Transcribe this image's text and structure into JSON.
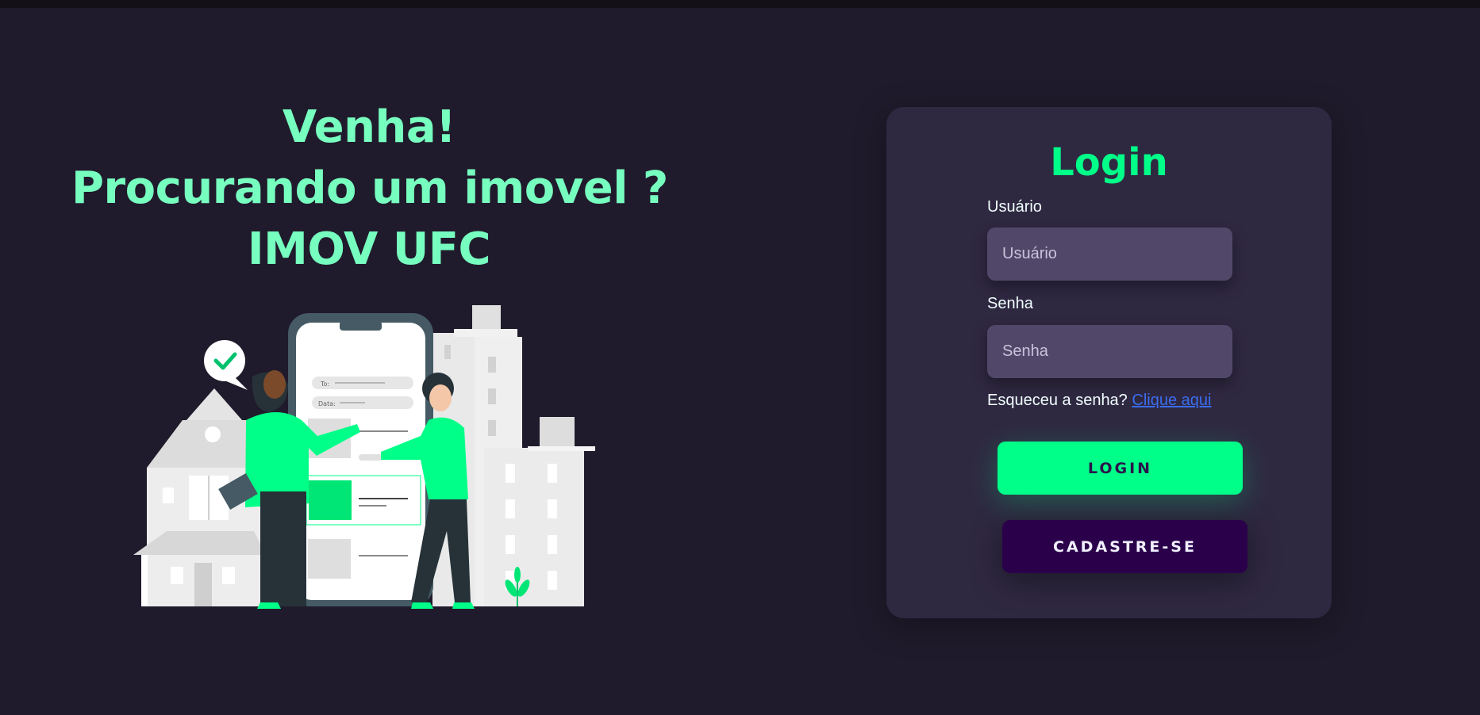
{
  "hero": {
    "line1": "Venha!",
    "line2": "Procurando um imovel ?",
    "line3": "IMOV UFC"
  },
  "illustration": {
    "search_to_label": "To:",
    "search_date_label": "Data:"
  },
  "login": {
    "title": "Login",
    "username_label": "Usuário",
    "username_placeholder": "Usuário",
    "username_value": "",
    "password_label": "Senha",
    "password_placeholder": "Senha",
    "password_value": "",
    "forgot_text": "Esqueceu a senha?",
    "forgot_link": "Clique aqui",
    "login_button": "LOGIN",
    "signup_button": "CADASTRE-SE"
  },
  "colors": {
    "background": "#201b2c",
    "card": "#2f2841",
    "accent": "#00ff88",
    "hero_text": "#77ffc0",
    "input": "#514869",
    "signup_button": "#2b004b",
    "link": "#3a6df0"
  }
}
